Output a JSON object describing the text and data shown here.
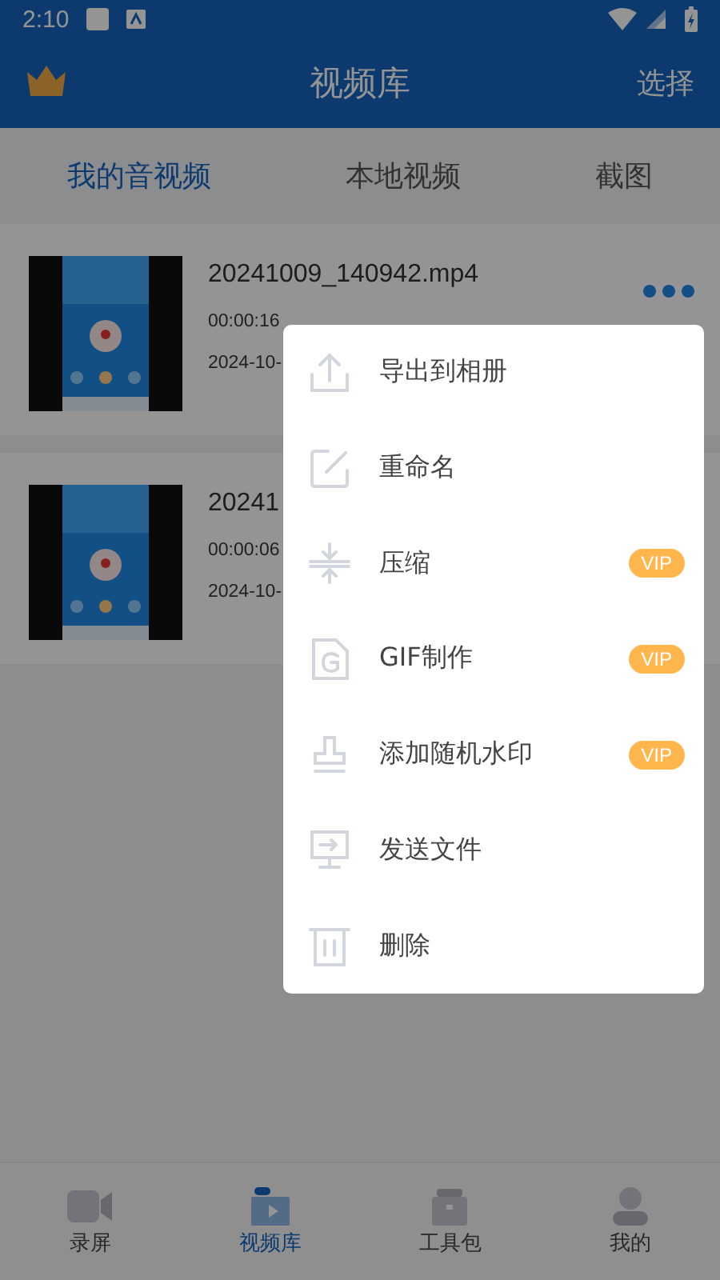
{
  "status_bar": {
    "time": "2:10"
  },
  "header": {
    "title": "视频库",
    "action": "选择"
  },
  "tabs": [
    {
      "label": "我的音视频",
      "selected": true
    },
    {
      "label": "本地视频",
      "selected": false
    },
    {
      "label": "截图",
      "selected": false
    }
  ],
  "videos": [
    {
      "name": "20241009_140942.mp4",
      "duration": "00:00:16",
      "date": "2024-10-"
    },
    {
      "name": "20241",
      "duration": "00:00:06",
      "date": "2024-10-"
    }
  ],
  "menu": [
    {
      "label": "导出到相册",
      "vip": false
    },
    {
      "label": "重命名",
      "vip": false
    },
    {
      "label": "压缩",
      "vip": true,
      "badge": "VIP"
    },
    {
      "label": "GIF制作",
      "vip": true,
      "badge": "VIP"
    },
    {
      "label": "添加随机水印",
      "vip": true,
      "badge": "VIP"
    },
    {
      "label": "发送文件",
      "vip": false
    },
    {
      "label": "删除",
      "vip": false
    }
  ],
  "bottom_nav": [
    {
      "label": "录屏",
      "selected": false
    },
    {
      "label": "视频库",
      "selected": true
    },
    {
      "label": "工具包",
      "selected": false
    },
    {
      "label": "我的",
      "selected": false
    }
  ]
}
